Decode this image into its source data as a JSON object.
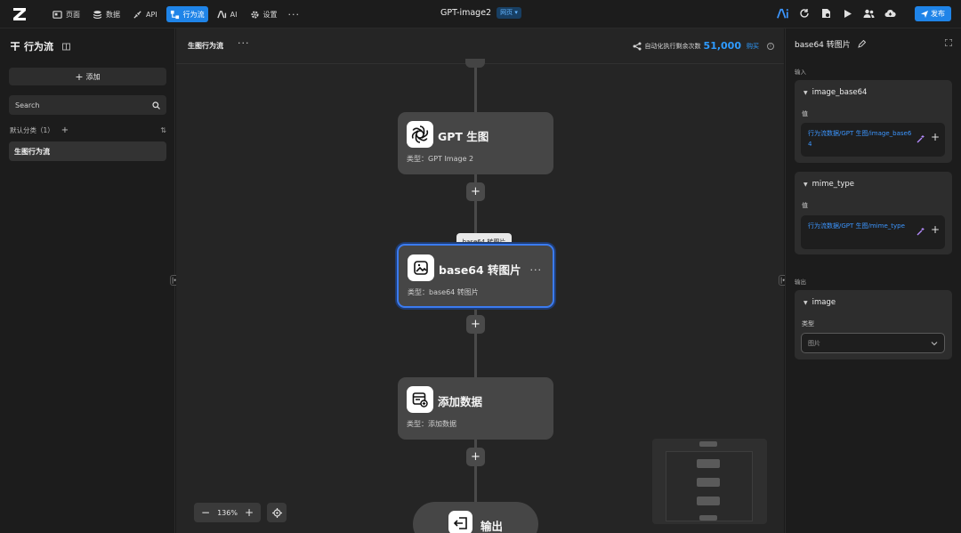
{
  "topbar": {
    "nav": [
      {
        "label": "页面",
        "icon": "page-icon"
      },
      {
        "label": "数据",
        "icon": "database-icon"
      },
      {
        "label": "API",
        "icon": "api-icon"
      },
      {
        "label": "行为流",
        "icon": "flow-icon",
        "active": true
      },
      {
        "label": "AI",
        "icon": "ai-icon"
      },
      {
        "label": "设置",
        "icon": "gear-icon"
      }
    ],
    "more": "···",
    "app_title": "GPT-image2",
    "badge": "网页 ▾",
    "publish": "发布"
  },
  "sidebar": {
    "title": "行为流",
    "add_label": "添加",
    "search_placeholder": "Search",
    "category": "默认分类（1）",
    "items": [
      {
        "label": "生图行为流"
      }
    ]
  },
  "canvas": {
    "title": "生图行为流",
    "more": "···",
    "quota_label": "自动化执行剩余次数",
    "quota_value": "51,000",
    "buy_label": "购买",
    "tooltip": "base64 转图片",
    "nodes": [
      {
        "title": "GPT 生图",
        "subtitle": "类型：GPT Image 2"
      },
      {
        "title": "base64 转图片",
        "subtitle": "类型：base64 转图片",
        "selected": true
      },
      {
        "title": "添加数据",
        "subtitle": "类型：添加数据"
      }
    ],
    "output_node": "输出",
    "zoom": "136%",
    "colors": {
      "accent": "#1f84e8",
      "selected_border": "#3b7bf0",
      "link": "#3c96ff"
    }
  },
  "panel": {
    "title": "base64 转图片",
    "input_section": "输入",
    "inputs": [
      {
        "name": "image_base64",
        "value_label": "值",
        "value": "行为流数据/GPT 生图/image_base64"
      },
      {
        "name": "mime_type",
        "value_label": "值",
        "value": "行为流数据/GPT 生图/mime_type"
      }
    ],
    "output_section": "输出",
    "output": {
      "name": "image",
      "type_label": "类型",
      "type_value": "图片"
    }
  }
}
